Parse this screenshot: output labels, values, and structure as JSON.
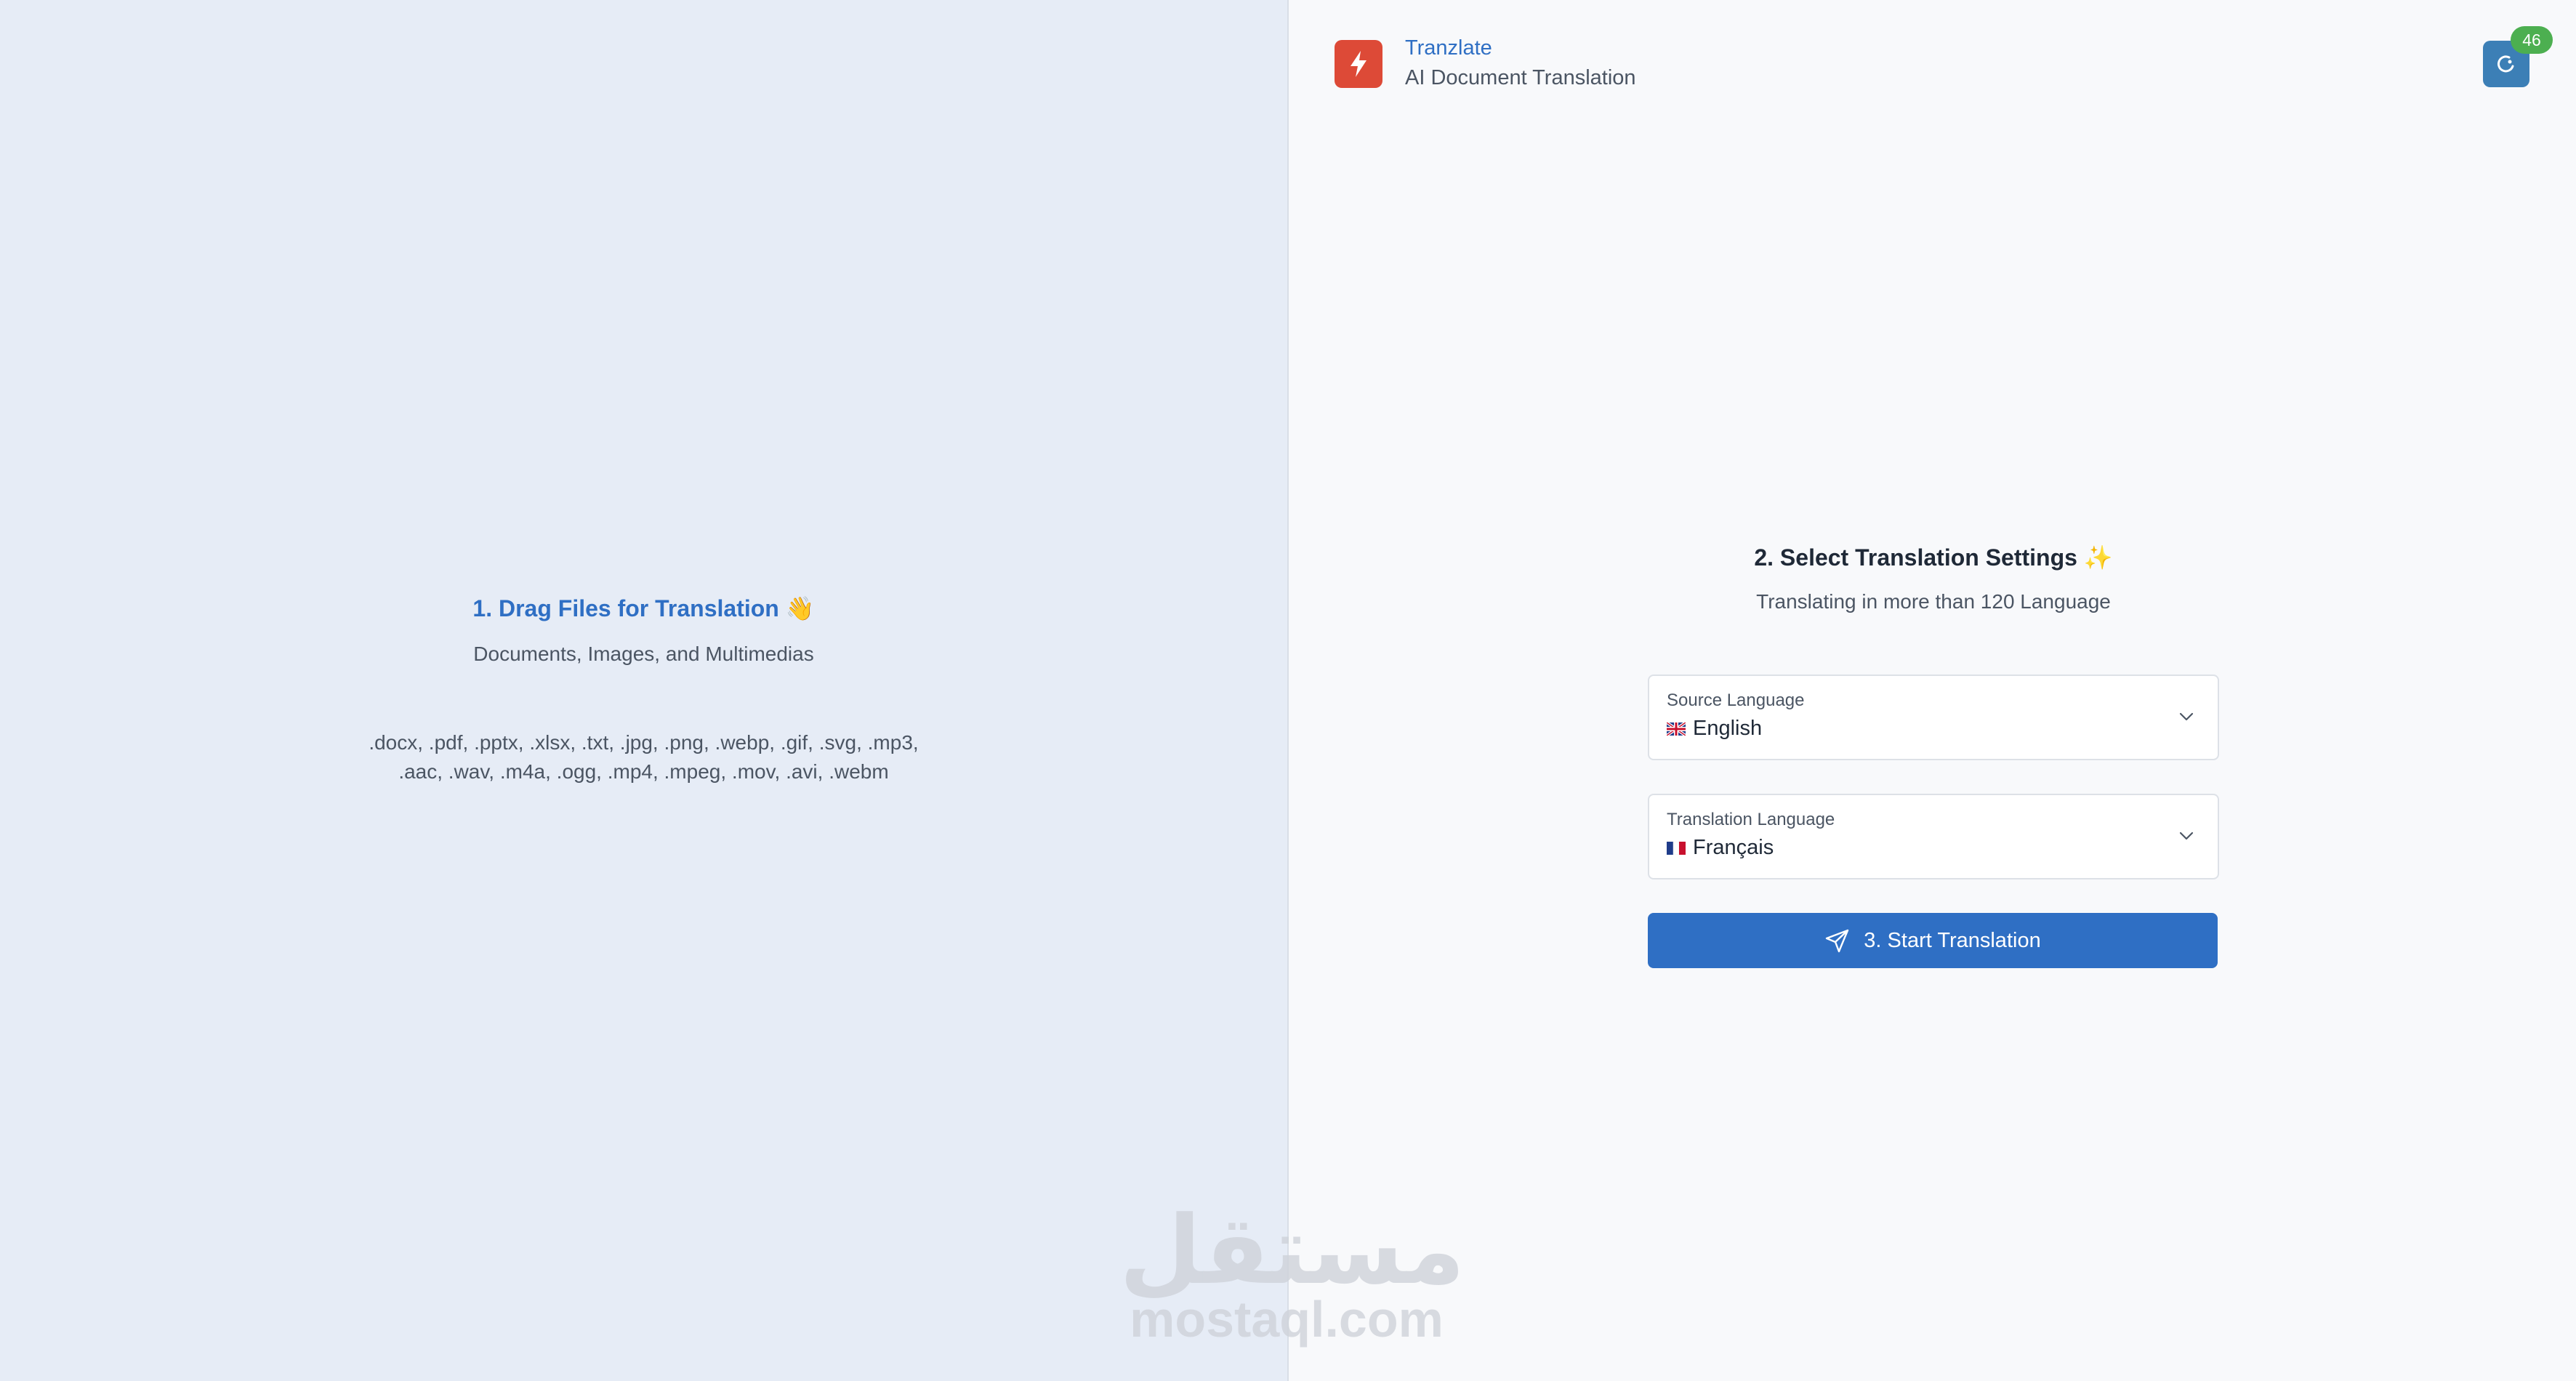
{
  "upload": {
    "title": "1. Drag Files for Translation",
    "title_emoji": "👋",
    "subtitle": "Documents, Images, and Multimedias",
    "formats_line1": ".docx, .pdf, .pptx, .xlsx, .txt, .jpg, .png, .webp, .gif, .svg, .mp3,",
    "formats_line2": ".aac, .wav, .m4a, .ogg, .mp4, .mpeg, .mov, .avi, .webm"
  },
  "header": {
    "brand_name": "Tranzlate",
    "tagline": "AI Document Translation",
    "logo_icon": "lightning-icon",
    "user_icon": "user-icon",
    "badge_count": "46",
    "colors": {
      "logo_bg": "#dd4a37",
      "accent": "#2f6fc4",
      "badge": "#4caf50"
    }
  },
  "settings": {
    "title": "2. Select Translation Settings",
    "title_emoji": "✨",
    "subtitle": "Translating in more than 120 Language",
    "source": {
      "label": "Source Language",
      "value": "English",
      "flag": "uk-flag-icon"
    },
    "target": {
      "label": "Translation Language",
      "value": "Français",
      "flag": "fr-flag-icon"
    },
    "start_label": "3. Start Translation",
    "start_icon": "send-icon"
  },
  "watermark": {
    "arabic": "مستقل",
    "latin": "mostaql.com"
  }
}
